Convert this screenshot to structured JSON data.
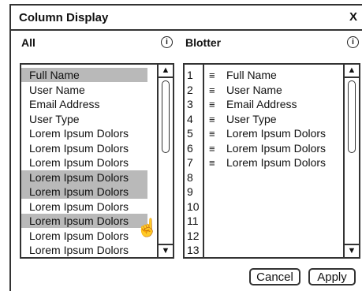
{
  "dialog": {
    "title": "Column Display",
    "close_label": "X"
  },
  "left_panel": {
    "heading": "All",
    "info_icon": "i",
    "items": [
      {
        "label": "Full Name",
        "selected": true
      },
      {
        "label": "User Name",
        "selected": false
      },
      {
        "label": "Email Address",
        "selected": false
      },
      {
        "label": "User Type",
        "selected": false
      },
      {
        "label": "Lorem Ipsum Dolors",
        "selected": false
      },
      {
        "label": "Lorem Ipsum Dolors",
        "selected": false
      },
      {
        "label": "Lorem Ipsum Dolors",
        "selected": false
      },
      {
        "label": "Lorem Ipsum Dolors",
        "selected": true
      },
      {
        "label": "Lorem Ipsum Dolors",
        "selected": true
      },
      {
        "label": "Lorem Ipsum Dolors",
        "selected": false
      },
      {
        "label": "Lorem Ipsum Dolors",
        "selected": true
      },
      {
        "label": "Lorem Ipsum Dolors",
        "selected": false
      },
      {
        "label": "Lorem Ipsum Dolors",
        "selected": false
      }
    ]
  },
  "right_panel": {
    "heading": "Blotter",
    "info_icon": "i",
    "rows": [
      {
        "num": "1",
        "label": "Full Name"
      },
      {
        "num": "2",
        "label": "User Name"
      },
      {
        "num": "3",
        "label": "Email Address"
      },
      {
        "num": "4",
        "label": "User Type"
      },
      {
        "num": "5",
        "label": "Lorem Ipsum Dolors"
      },
      {
        "num": "6",
        "label": "Lorem Ipsum Dolors"
      },
      {
        "num": "7",
        "label": "Lorem Ipsum Dolors"
      },
      {
        "num": "8",
        "label": ""
      },
      {
        "num": "9",
        "label": ""
      },
      {
        "num": "10",
        "label": ""
      },
      {
        "num": "11",
        "label": ""
      },
      {
        "num": "12",
        "label": ""
      },
      {
        "num": "13",
        "label": ""
      }
    ]
  },
  "buttons": {
    "cancel": "Cancel",
    "apply": "Apply"
  },
  "icons": {
    "scroll_up": "▲",
    "scroll_down": "▼",
    "grip": "≡",
    "hand_cursor": "☝"
  }
}
